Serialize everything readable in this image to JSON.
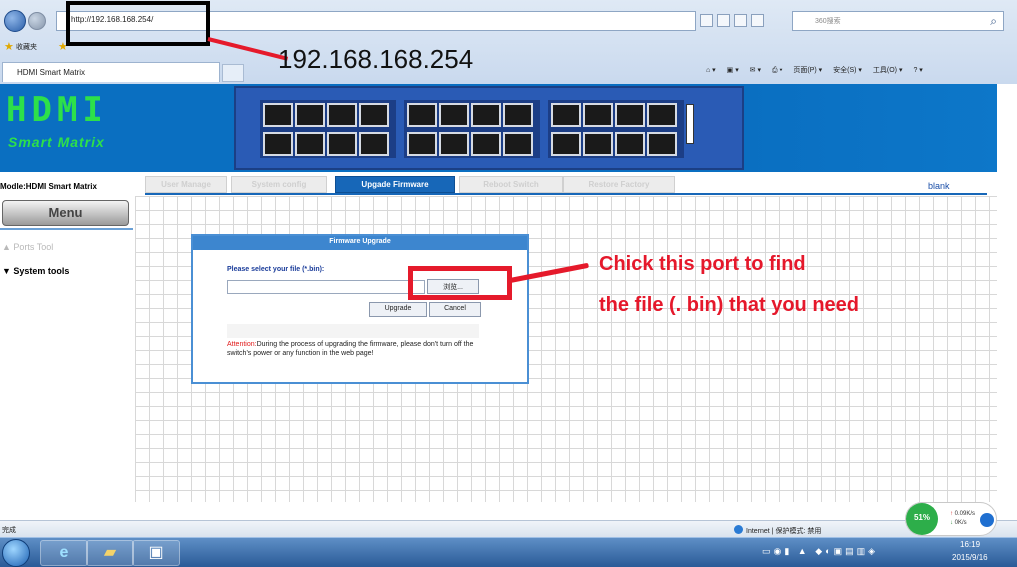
{
  "browser": {
    "address": "http://192.168.168.254/",
    "search_placeholder": "360搜索",
    "favorites_label": "收藏夹",
    "tab_title": "HDMI Smart Matrix",
    "commands": [
      "页面(P) ▾",
      "安全(S) ▾",
      "工具(O) ▾"
    ]
  },
  "annotations": {
    "ip": "192.168.168.254",
    "note_line1": "Chick this port to find",
    "note_line2": "the file (. bin) that you need"
  },
  "header": {
    "logo_main": "HDMI",
    "logo_sub": "Smart Matrix"
  },
  "sidebar": {
    "model": "Modle:HDMI Smart Matrix",
    "menu_label": "Menu",
    "items": [
      {
        "label": "▲ Ports Tool"
      },
      {
        "label": "▼ System tools"
      }
    ]
  },
  "tabs": [
    {
      "label": "User Manage"
    },
    {
      "label": "System config"
    },
    {
      "label": "Upgade Firmware"
    },
    {
      "label": "Reboot Switch"
    },
    {
      "label": "Restore Factory"
    }
  ],
  "blank_link": "blank",
  "firmware": {
    "title": "Firmware Upgrade",
    "prompt": "Please select your file (*.bin):",
    "file_value": "",
    "browse_label": "浏览...",
    "upgrade_label": "Upgrade",
    "cancel_label": "Cancel",
    "attention_label": "Attention:",
    "attention_text": "During the process of upgrading the firmware, please don't turn off the switch's power or any function in the web page!"
  },
  "status": {
    "left_text": "完成",
    "zone_text": "Internet | 保护模式: 禁用",
    "net_percent": "51%",
    "upload": "0.09K/s",
    "download": "0K/s"
  },
  "taskbar": {
    "time": "16:19",
    "date": "2015/9/16"
  },
  "colors": {
    "accent": "#1767b8",
    "annotation_red": "#e51a2b",
    "header_blue": "#0a6fc1",
    "logo_green": "#2de04a"
  }
}
